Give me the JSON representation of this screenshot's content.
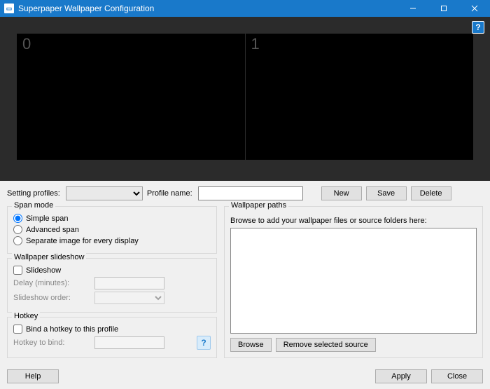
{
  "window": {
    "title": "Superpaper Wallpaper Configuration"
  },
  "preview": {
    "monitors": [
      "0",
      "1"
    ]
  },
  "profiles": {
    "label": "Setting profiles:",
    "name_label": "Profile name:",
    "name_value": "",
    "new_btn": "New",
    "save_btn": "Save",
    "delete_btn": "Delete"
  },
  "span": {
    "group_title": "Span mode",
    "simple": "Simple span",
    "advanced": "Advanced span",
    "separate": "Separate image for every display"
  },
  "slideshow": {
    "group_title": "Wallpaper slideshow",
    "enable": "Slideshow",
    "delay_label": "Delay (minutes):",
    "delay_value": "",
    "order_label": "Slideshow order:"
  },
  "hotkey": {
    "group_title": "Hotkey",
    "enable": "Bind a hotkey to this profile",
    "label": "Hotkey to bind:",
    "value": ""
  },
  "paths": {
    "group_title": "Wallpaper paths",
    "hint": "Browse to add your wallpaper files or source folders here:",
    "browse_btn": "Browse",
    "remove_btn": "Remove selected source"
  },
  "footer": {
    "help_btn": "Help",
    "apply_btn": "Apply",
    "close_btn": "Close"
  }
}
